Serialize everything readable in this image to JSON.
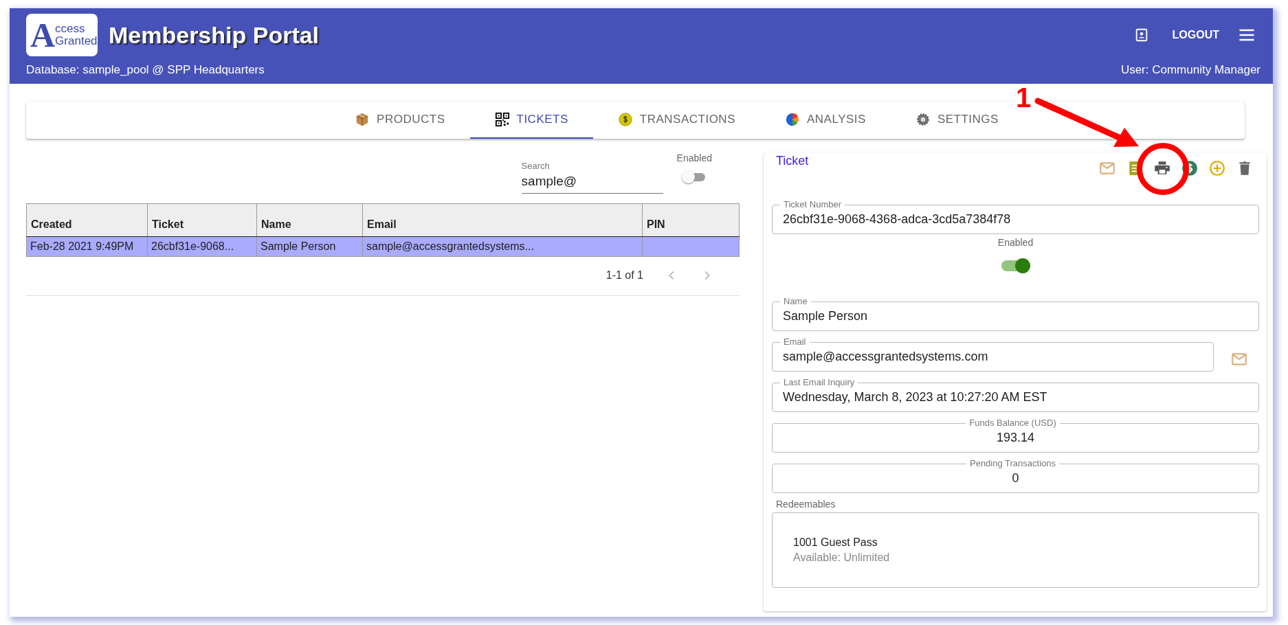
{
  "header": {
    "logo": {
      "big_letter": "A",
      "line_1": "ccess",
      "line_2": "Granted"
    },
    "title": "Membership Portal",
    "database": "Database: sample_pool @ SPP Headquarters",
    "user": "User: Community Manager",
    "logout": "LOGOUT"
  },
  "tabs": [
    {
      "label": "PRODUCTS",
      "kind": "box",
      "selected": false
    },
    {
      "label": "TICKETS",
      "kind": "qr",
      "selected": true
    },
    {
      "label": "TRANSACTIONS",
      "kind": "coin",
      "selected": false
    },
    {
      "label": "ANALYSIS",
      "kind": "pie",
      "selected": false
    },
    {
      "label": "SETTINGS",
      "kind": "gear",
      "selected": false
    }
  ],
  "search": {
    "label": "Search",
    "value": "sample@"
  },
  "enabled_filter": {
    "label": "Enabled",
    "on": false
  },
  "table": {
    "columns": [
      "Created",
      "Ticket",
      "Name",
      "Email",
      "PIN"
    ],
    "rows": [
      {
        "cells": [
          "Feb-28 2021 9:49PM",
          "26cbf31e-9068...",
          "Sample Person",
          "sample@accessgrantedsystems...",
          ""
        ],
        "selected": true
      }
    ]
  },
  "pagination": {
    "range": "1-1 of 1"
  },
  "ticket": {
    "title": "Ticket",
    "toolbar": [
      {
        "kind": "mail"
      },
      {
        "kind": "receipt"
      },
      {
        "kind": "print"
      },
      {
        "kind": "dollar"
      },
      {
        "kind": "add"
      },
      {
        "kind": "trash"
      }
    ],
    "ticket_number": {
      "label": "Ticket Number",
      "value": "26cbf31e-9068-4368-adca-3cd5a7384f78"
    },
    "enabled": {
      "label": "Enabled",
      "on": true
    },
    "fields": [
      {
        "kind": "text",
        "label": "Name",
        "value": "Sample Person"
      },
      {
        "kind": "email",
        "label": "Email",
        "value": "sample@accessgrantedsystems.com"
      },
      {
        "kind": "text",
        "label": "Last Email Inquiry",
        "value": "Wednesday, March 8, 2023 at 10:27:20 AM EST"
      },
      {
        "kind": "amount",
        "label": "Funds Balance (USD)",
        "value": "193.14"
      },
      {
        "kind": "amount",
        "label": "Pending Transactions",
        "value": "0"
      }
    ],
    "redeemables": {
      "label": "Redeemables",
      "items": [
        {
          "name": "1001 Guest Pass",
          "detail": "Available: Unlimited"
        }
      ]
    }
  },
  "annotation": {
    "label": "1"
  }
}
